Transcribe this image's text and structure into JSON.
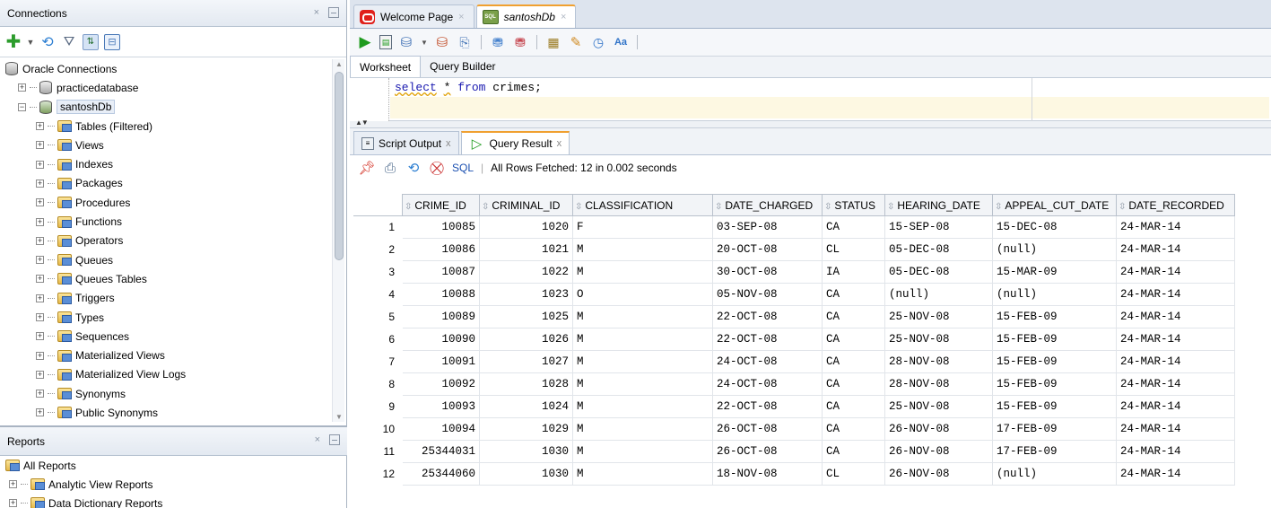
{
  "connections_panel": {
    "title": "Connections",
    "toolbar_icons": [
      "add-icon",
      "dropdown-icon",
      "refresh-icon",
      "filter-icon",
      "schema-browser-icon",
      "collapse-icon"
    ],
    "tree": [
      {
        "label": "Oracle Connections",
        "icon": "database-icon",
        "level": 0
      },
      {
        "label": "practicedatabase",
        "icon": "database-icon",
        "level": 1,
        "expander": "+"
      },
      {
        "label": "santoshDb",
        "icon": "connection-icon",
        "level": 1,
        "expander": "-",
        "selected": true
      },
      {
        "label": "Tables (Filtered)",
        "icon": "folder-icon",
        "level": 2,
        "expander": "+"
      },
      {
        "label": "Views",
        "icon": "folder-icon",
        "level": 2,
        "expander": "+"
      },
      {
        "label": "Indexes",
        "icon": "folder-icon",
        "level": 2,
        "expander": "+"
      },
      {
        "label": "Packages",
        "icon": "folder-icon",
        "level": 2,
        "expander": "+"
      },
      {
        "label": "Procedures",
        "icon": "folder-icon",
        "level": 2,
        "expander": "+"
      },
      {
        "label": "Functions",
        "icon": "folder-icon",
        "level": 2,
        "expander": "+"
      },
      {
        "label": "Operators",
        "icon": "folder-icon",
        "level": 2,
        "expander": "+"
      },
      {
        "label": "Queues",
        "icon": "folder-icon",
        "level": 2,
        "expander": "+"
      },
      {
        "label": "Queues Tables",
        "icon": "folder-icon",
        "level": 2,
        "expander": "+"
      },
      {
        "label": "Triggers",
        "icon": "folder-icon",
        "level": 2,
        "expander": "+"
      },
      {
        "label": "Types",
        "icon": "folder-icon",
        "level": 2,
        "expander": "+"
      },
      {
        "label": "Sequences",
        "icon": "folder-icon",
        "level": 2,
        "expander": "+"
      },
      {
        "label": "Materialized Views",
        "icon": "folder-icon",
        "level": 2,
        "expander": "+"
      },
      {
        "label": "Materialized View Logs",
        "icon": "folder-icon",
        "level": 2,
        "expander": "+"
      },
      {
        "label": "Synonyms",
        "icon": "folder-icon",
        "level": 2,
        "expander": "+"
      },
      {
        "label": "Public Synonyms",
        "icon": "folder-icon",
        "level": 2,
        "expander": "+"
      }
    ]
  },
  "reports_panel": {
    "title": "Reports",
    "items": [
      {
        "label": "All Reports",
        "level": 0
      },
      {
        "label": "Analytic View Reports",
        "level": 1,
        "expander": "+"
      },
      {
        "label": "Data Dictionary Reports",
        "level": 1,
        "expander": "+"
      }
    ]
  },
  "doc_tabs": [
    {
      "label": "Welcome Page",
      "icon": "oracle-icon",
      "italic": false,
      "active": false
    },
    {
      "label": "santoshDb",
      "icon": "sql-worksheet-icon",
      "italic": true,
      "active": true
    }
  ],
  "worksheet_tabs": [
    "Worksheet",
    "Query Builder"
  ],
  "editor": {
    "kw1": "select",
    "star": "*",
    "kw2": "from",
    "rest": "crimes;"
  },
  "result_tabs": [
    {
      "label": "Script Output",
      "close": "x"
    },
    {
      "label": "Query Result",
      "close": "x"
    }
  ],
  "result_toolbar": {
    "sql_label": "SQL",
    "separator": "|",
    "status": "All Rows Fetched: 12 in 0.002 seconds"
  },
  "grid": {
    "columns": [
      "CRIME_ID",
      "CRIMINAL_ID",
      "CLASSIFICATION",
      "DATE_CHARGED",
      "STATUS",
      "HEARING_DATE",
      "APPEAL_CUT_DATE",
      "DATE_RECORDED"
    ],
    "rows": [
      [
        "1",
        "10085",
        "1020",
        "F",
        "03-SEP-08",
        "CA",
        "15-SEP-08",
        "15-DEC-08",
        "24-MAR-14"
      ],
      [
        "2",
        "10086",
        "1021",
        "M",
        "20-OCT-08",
        "CL",
        "05-DEC-08",
        "(null)",
        "24-MAR-14"
      ],
      [
        "3",
        "10087",
        "1022",
        "M",
        "30-OCT-08",
        "IA",
        "05-DEC-08",
        "15-MAR-09",
        "24-MAR-14"
      ],
      [
        "4",
        "10088",
        "1023",
        "O",
        "05-NOV-08",
        "CA",
        "(null)",
        "(null)",
        "24-MAR-14"
      ],
      [
        "5",
        "10089",
        "1025",
        "M",
        "22-OCT-08",
        "CA",
        "25-NOV-08",
        "15-FEB-09",
        "24-MAR-14"
      ],
      [
        "6",
        "10090",
        "1026",
        "M",
        "22-OCT-08",
        "CA",
        "25-NOV-08",
        "15-FEB-09",
        "24-MAR-14"
      ],
      [
        "7",
        "10091",
        "1027",
        "M",
        "24-OCT-08",
        "CA",
        "28-NOV-08",
        "15-FEB-09",
        "24-MAR-14"
      ],
      [
        "8",
        "10092",
        "1028",
        "M",
        "24-OCT-08",
        "CA",
        "28-NOV-08",
        "15-FEB-09",
        "24-MAR-14"
      ],
      [
        "9",
        "10093",
        "1024",
        "M",
        "22-OCT-08",
        "CA",
        "25-NOV-08",
        "15-FEB-09",
        "24-MAR-14"
      ],
      [
        "10",
        "10094",
        "1029",
        "M",
        "26-OCT-08",
        "CA",
        "26-NOV-08",
        "17-FEB-09",
        "24-MAR-14"
      ],
      [
        "11",
        "25344031",
        "1030",
        "M",
        "26-OCT-08",
        "CA",
        "26-NOV-08",
        "17-FEB-09",
        "24-MAR-14"
      ],
      [
        "12",
        "25344060",
        "1030",
        "M",
        "18-NOV-08",
        "CL",
        "26-NOV-08",
        "(null)",
        "24-MAR-14"
      ]
    ]
  },
  "colors": {
    "accent_tab": "#f0a030",
    "sql_keyword": "#1a1ab0",
    "link": "#1a4fb0",
    "selection": "#e8eef7"
  }
}
